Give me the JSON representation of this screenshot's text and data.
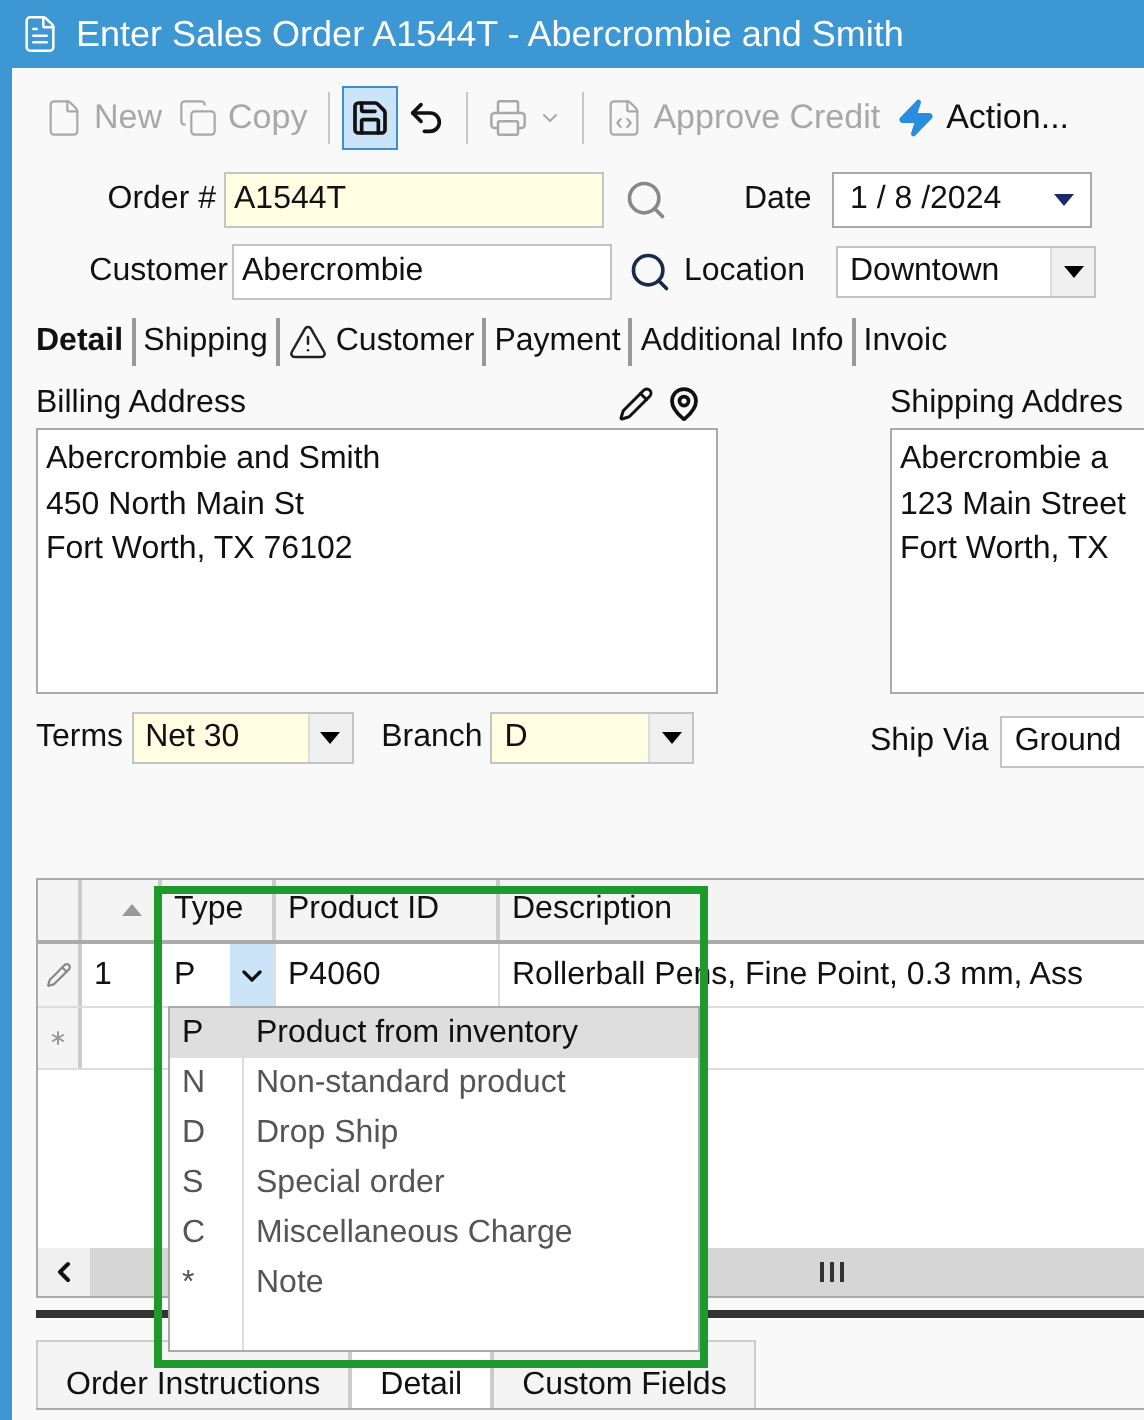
{
  "window": {
    "title": "Enter Sales Order A1544T - Abercrombie and Smith"
  },
  "toolbar": [
    {
      "kind": "new",
      "label": "New",
      "disabled": true,
      "pressed": false
    },
    {
      "kind": "copy",
      "label": "Copy",
      "disabled": true,
      "pressed": false
    },
    {
      "kind": "separator"
    },
    {
      "kind": "save",
      "disabled": false,
      "pressed": true
    },
    {
      "kind": "undo",
      "disabled": false,
      "pressed": false
    },
    {
      "kind": "separator"
    },
    {
      "kind": "print",
      "disabled": true,
      "pressed": false
    },
    {
      "kind": "separator"
    },
    {
      "kind": "approve",
      "label": "Approve Credit",
      "disabled": true,
      "pressed": false
    },
    {
      "kind": "action",
      "label": "Action...",
      "disabled": false,
      "pressed": false
    }
  ],
  "header": {
    "order_label": "Order #",
    "order_value": "A1544T",
    "date_label": "Date",
    "date_value": "1 / 8 /2024",
    "customer_label": "Customer",
    "customer_value": "Abercrombie",
    "location_label": "Location",
    "location_value": "Downtown"
  },
  "tabs": [
    {
      "label": "Detail",
      "selected": true,
      "warning": false
    },
    {
      "label": "Shipping",
      "selected": false,
      "warning": false
    },
    {
      "label": "Customer",
      "selected": false,
      "warning": true
    },
    {
      "label": "Payment",
      "selected": false,
      "warning": false
    },
    {
      "label": "Additional Info",
      "selected": false,
      "warning": false
    },
    {
      "label": "Invoic",
      "selected": false,
      "warning": false
    }
  ],
  "billing": {
    "label": "Billing Address",
    "lines": [
      "Abercrombie and Smith",
      "450 North Main St",
      "Fort Worth, TX 76102"
    ]
  },
  "shipping": {
    "label": "Shipping Addres",
    "lines": [
      "Abercrombie a",
      "123 Main Street",
      "Fort Worth, TX"
    ]
  },
  "terms": {
    "terms_label": "Terms",
    "terms_value": "Net 30",
    "branch_label": "Branch",
    "branch_value": "D",
    "ship_via_label": "Ship Via",
    "ship_via_value": "Ground"
  },
  "grid": {
    "columns": [
      "Type",
      "Product ID",
      "Description"
    ],
    "rows": [
      {
        "number": "1",
        "type": "P",
        "product_id": "P4060",
        "description": "Rollerball Pens, Fine Point, 0.3 mm, Ass"
      }
    ]
  },
  "type_dropdown": [
    {
      "code": "P",
      "label": "Product from inventory",
      "selected": true
    },
    {
      "code": "N",
      "label": "Non-standard product",
      "selected": false
    },
    {
      "code": "D",
      "label": "Drop Ship",
      "selected": false
    },
    {
      "code": "S",
      "label": "Special order",
      "selected": false
    },
    {
      "code": "C",
      "label": "Miscellaneous Charge",
      "selected": false
    },
    {
      "code": "*",
      "label": "Note",
      "selected": false
    }
  ],
  "bottom_tabs": [
    {
      "label": "Order Instructions",
      "selected": false
    },
    {
      "label": "Detail",
      "selected": true
    },
    {
      "label": "Custom Fields",
      "selected": false
    }
  ]
}
